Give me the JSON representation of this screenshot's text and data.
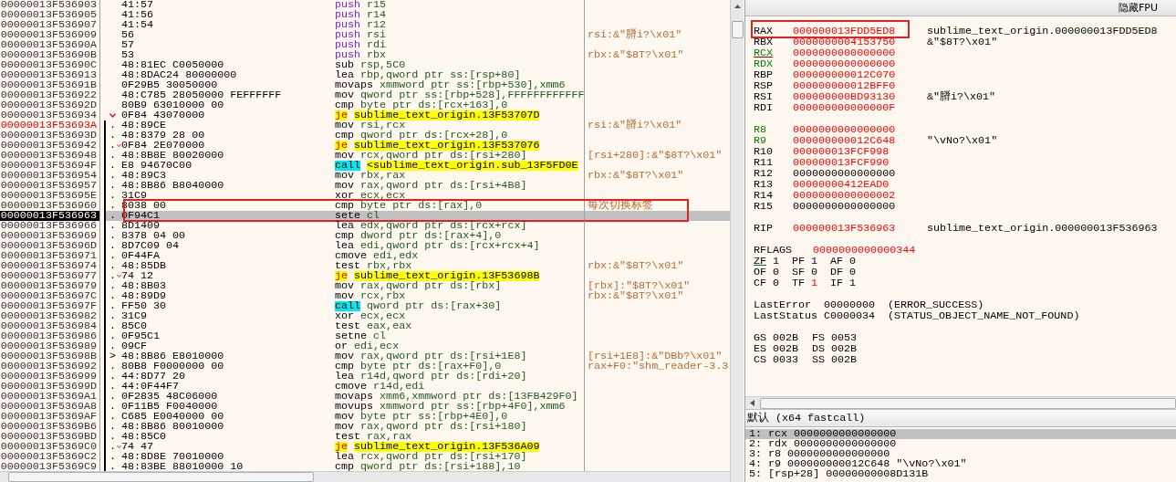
{
  "disassembly": {
    "rows": [
      {
        "address": "00000013F536903",
        "bytes": "41:57",
        "mnemonic": "push",
        "operands": "r15",
        "kind": "push",
        "jump": false,
        "in_branch": false,
        "highlighted": false,
        "selected": false,
        "boxed": false
      },
      {
        "address": "00000013F536905",
        "bytes": "41:56",
        "mnemonic": "push",
        "operands": "r14",
        "kind": "push",
        "jump": false,
        "in_branch": false,
        "highlighted": false,
        "selected": false,
        "boxed": false
      },
      {
        "address": "00000013F536907",
        "bytes": "41:54",
        "mnemonic": "push",
        "operands": "r12",
        "kind": "push",
        "jump": false,
        "in_branch": false,
        "highlighted": false,
        "selected": false,
        "boxed": false
      },
      {
        "address": "00000013F536909",
        "bytes": "56",
        "mnemonic": "push",
        "operands": "rsi",
        "kind": "push",
        "comment": "rsi:&\"膌i?\\x01\"",
        "jump": false,
        "in_branch": false,
        "highlighted": false,
        "selected": false,
        "boxed": false
      },
      {
        "address": "00000013F53690A",
        "bytes": "57",
        "mnemonic": "push",
        "operands": "rdi",
        "kind": "push",
        "jump": false,
        "in_branch": false,
        "highlighted": false,
        "selected": false,
        "boxed": false
      },
      {
        "address": "00000013F53690B",
        "bytes": "53",
        "mnemonic": "push",
        "operands": "rbx",
        "kind": "push",
        "comment": "rbx:&\"$8T?\\x01\"",
        "jump": false,
        "in_branch": false,
        "highlighted": false,
        "selected": false,
        "boxed": false
      },
      {
        "address": "00000013F53690C",
        "bytes": "48:81EC C0050000",
        "mnemonic": "sub",
        "operands": "rsp,5C0",
        "kind": "plain",
        "jump": false,
        "in_branch": false,
        "highlighted": false,
        "selected": false,
        "boxed": false
      },
      {
        "address": "00000013F536913",
        "bytes": "48:8DAC24 80000000",
        "mnemonic": "lea",
        "operands": "rbp,qword ptr ss:[rsp+80]",
        "kind": "plain",
        "jump": false,
        "in_branch": false,
        "highlighted": false,
        "selected": false,
        "boxed": false
      },
      {
        "address": "00000013F53691B",
        "bytes": "0F29B5 30050000",
        "mnemonic": "movaps",
        "operands": "xmmword ptr ss:[rbp+530],xmm6",
        "kind": "plain",
        "jump": false,
        "in_branch": false,
        "highlighted": false,
        "selected": false,
        "boxed": false
      },
      {
        "address": "00000013F536922",
        "bytes": "48:C785 28050000 FEFFFFFF",
        "mnemonic": "mov",
        "operands": "qword ptr ss:[rbp+528],FFFFFFFFFFFF",
        "kind": "plain",
        "jump": false,
        "in_branch": false,
        "highlighted": false,
        "selected": false,
        "boxed": false
      },
      {
        "address": "00000013F53692D",
        "bytes": "80B9 63010000 00",
        "mnemonic": "cmp",
        "operands": "byte ptr ds:[rcx+163],0",
        "kind": "plain",
        "jump": false,
        "in_branch": false,
        "highlighted": false,
        "selected": false,
        "boxed": false
      },
      {
        "address": "00000013F536934",
        "bytes": "0F84 43070000",
        "mnemonic": "je",
        "operands": "sublime_text_origin.13F53707D",
        "kind": "jump",
        "jump": true,
        "in_branch": false,
        "highlighted": false,
        "selected": false,
        "boxed": false
      },
      {
        "address": "00000013F53693A",
        "gutter": ".",
        "bytes": "48:89CE",
        "mnemonic": "mov",
        "operands": "rsi,rcx",
        "kind": "plain",
        "comment": "rsi:&\"膌i?\\x01\"",
        "jump": false,
        "in_branch": true,
        "highlighted": true,
        "selected": false,
        "boxed": false
      },
      {
        "address": "00000013F53693D",
        "gutter": ".",
        "bytes": "48:8379 28 00",
        "mnemonic": "cmp",
        "operands": "qword ptr ds:[rcx+28],0",
        "kind": "plain",
        "jump": false,
        "in_branch": true,
        "highlighted": false,
        "selected": false,
        "boxed": false
      },
      {
        "address": "00000013F536942",
        "gutter": ".",
        "bytes": "0F84 2E070000",
        "mnemonic": "je",
        "operands": "sublime_text_origin.13F537076",
        "kind": "jump",
        "jump": true,
        "in_branch": true,
        "highlighted": false,
        "selected": false,
        "boxed": false
      },
      {
        "address": "00000013F536948",
        "gutter": ".",
        "bytes": "48:8B8E 80020000",
        "mnemonic": "mov",
        "operands": "rcx,qword ptr ds:[rsi+280]",
        "kind": "plain",
        "comment": "[rsi+280]:&\"$8T?\\x01\"",
        "jump": false,
        "in_branch": true,
        "highlighted": false,
        "selected": false,
        "boxed": false
      },
      {
        "address": "00000013F53694F",
        "gutter": ".",
        "bytes": "E8 94670C00",
        "mnemonic": "call",
        "operands": "<sublime_text_origin.sub_13F5FD0E",
        "kind": "call_direct",
        "jump": false,
        "in_branch": true,
        "highlighted": false,
        "selected": false,
        "boxed": false
      },
      {
        "address": "00000013F536954",
        "gutter": ".",
        "bytes": "48:89C3",
        "mnemonic": "mov",
        "operands": "rbx,rax",
        "kind": "plain",
        "comment": "rbx:&\"$8T?\\x01\"",
        "jump": false,
        "in_branch": true,
        "highlighted": false,
        "selected": false,
        "boxed": false
      },
      {
        "address": "00000013F536957",
        "gutter": ".",
        "bytes": "48:8B86 B8040000",
        "mnemonic": "mov",
        "operands": "rax,qword ptr ds:[rsi+4B8]",
        "kind": "plain",
        "jump": false,
        "in_branch": true,
        "highlighted": false,
        "selected": false,
        "boxed": false
      },
      {
        "address": "00000013F53695E",
        "gutter": ".",
        "bytes": "31C9",
        "mnemonic": "xor",
        "operands": "ecx,ecx",
        "kind": "plain",
        "jump": false,
        "in_branch": true,
        "highlighted": false,
        "selected": false,
        "boxed": false
      },
      {
        "address": "00000013F536960",
        "gutter": ".",
        "bytes": "8038 00",
        "mnemonic": "cmp",
        "operands": "byte ptr ds:[rax],0",
        "kind": "plain",
        "comment": "每次切换标签",
        "jump": false,
        "in_branch": true,
        "highlighted": false,
        "selected": false,
        "boxed": true
      },
      {
        "address": "00000013F536963",
        "gutter": ".",
        "bytes": "0F94C1",
        "mnemonic": "sete",
        "operands": "cl",
        "kind": "plain",
        "jump": false,
        "in_branch": true,
        "highlighted": false,
        "selected": true,
        "boxed": true
      },
      {
        "address": "00000013F536966",
        "gutter": ".",
        "bytes": "8D1409",
        "mnemonic": "lea",
        "operands": "edx,qword ptr ds:[rcx+rcx]",
        "kind": "plain",
        "jump": false,
        "in_branch": true,
        "highlighted": false,
        "selected": false,
        "boxed": false
      },
      {
        "address": "00000013F536969",
        "gutter": ".",
        "bytes": "8378 04 00",
        "mnemonic": "cmp",
        "operands": "dword ptr ds:[rax+4],0",
        "kind": "plain",
        "jump": false,
        "in_branch": true,
        "highlighted": false,
        "selected": false,
        "boxed": false
      },
      {
        "address": "00000013F53696D",
        "gutter": ".",
        "bytes": "8D7C09 04",
        "mnemonic": "lea",
        "operands": "edi,qword ptr ds:[rcx+rcx+4]",
        "kind": "plain",
        "jump": false,
        "in_branch": true,
        "highlighted": false,
        "selected": false,
        "boxed": false
      },
      {
        "address": "00000013F536971",
        "gutter": ".",
        "bytes": "0F44FA",
        "mnemonic": "cmove",
        "operands": "edi,edx",
        "kind": "plain",
        "jump": false,
        "in_branch": true,
        "highlighted": false,
        "selected": false,
        "boxed": false
      },
      {
        "address": "00000013F536974",
        "gutter": ".",
        "bytes": "48:85DB",
        "mnemonic": "test",
        "operands": "rbx,rbx",
        "kind": "plain",
        "comment": "rbx:&\"$8T?\\x01\"",
        "jump": false,
        "in_branch": true,
        "highlighted": false,
        "selected": false,
        "boxed": false
      },
      {
        "address": "00000013F536977",
        "gutter": ".",
        "bytes": "74 12",
        "mnemonic": "je",
        "operands": "sublime_text_origin.13F53698B",
        "kind": "jump",
        "jump": true,
        "in_branch": true,
        "highlighted": false,
        "selected": false,
        "boxed": false
      },
      {
        "address": "00000013F536979",
        "gutter": ".",
        "bytes": "48:8B03",
        "mnemonic": "mov",
        "operands": "rax,qword ptr ds:[rbx]",
        "kind": "plain",
        "comment": "[rbx]:\"$8T?\\x01\"",
        "jump": false,
        "in_branch": true,
        "highlighted": false,
        "selected": false,
        "boxed": false
      },
      {
        "address": "00000013F53697C",
        "gutter": ".",
        "bytes": "48:89D9",
        "mnemonic": "mov",
        "operands": "rcx,rbx",
        "kind": "plain",
        "comment": "rbx:&\"$8T?\\x01\"",
        "jump": false,
        "in_branch": true,
        "highlighted": false,
        "selected": false,
        "boxed": false
      },
      {
        "address": "00000013F53697F",
        "gutter": ".",
        "bytes": "FF50 30",
        "mnemonic": "call",
        "operands": "qword ptr ds:[rax+30]",
        "kind": "call_indirect",
        "jump": false,
        "in_branch": true,
        "highlighted": false,
        "selected": false,
        "boxed": false
      },
      {
        "address": "00000013F536982",
        "gutter": ".",
        "bytes": "31C9",
        "mnemonic": "xor",
        "operands": "ecx,ecx",
        "kind": "plain",
        "jump": false,
        "in_branch": true,
        "highlighted": false,
        "selected": false,
        "boxed": false
      },
      {
        "address": "00000013F536984",
        "gutter": ".",
        "bytes": "85C0",
        "mnemonic": "test",
        "operands": "eax,eax",
        "kind": "plain",
        "jump": false,
        "in_branch": true,
        "highlighted": false,
        "selected": false,
        "boxed": false
      },
      {
        "address": "00000013F536986",
        "gutter": ".",
        "bytes": "0F95C1",
        "mnemonic": "setne",
        "operands": "cl",
        "kind": "plain",
        "jump": false,
        "in_branch": true,
        "highlighted": false,
        "selected": false,
        "boxed": false
      },
      {
        "address": "00000013F536989",
        "gutter": ".",
        "bytes": "09CF",
        "mnemonic": "or",
        "operands": "edi,ecx",
        "kind": "plain",
        "jump": false,
        "in_branch": true,
        "highlighted": false,
        "selected": false,
        "boxed": false
      },
      {
        "address": "00000013F53698B",
        "gutter": ">",
        "bytes": "48:8B86 E8010000",
        "mnemonic": "mov",
        "operands": "rax,qword ptr ds:[rsi+1E8]",
        "kind": "plain",
        "comment": "[rsi+1E8]:&\"DBb?\\x01\"",
        "jump": false,
        "in_branch": true,
        "highlighted": false,
        "selected": false,
        "boxed": false
      },
      {
        "address": "00000013F536992",
        "gutter": ".",
        "bytes": "80B8 F0000000 00",
        "mnemonic": "cmp",
        "operands": "byte ptr ds:[rax+F0],0",
        "kind": "plain",
        "comment": "rax+F0:\"shm_reader-3.3",
        "jump": false,
        "in_branch": true,
        "highlighted": false,
        "selected": false,
        "boxed": false
      },
      {
        "address": "00000013F536999",
        "gutter": ".",
        "bytes": "44:8D77 20",
        "mnemonic": "lea",
        "operands": "r14d,qword ptr ds:[rdi+20]",
        "kind": "plain",
        "jump": false,
        "in_branch": true,
        "highlighted": false,
        "selected": false,
        "boxed": false
      },
      {
        "address": "00000013F53699D",
        "gutter": ".",
        "bytes": "44:0F44F7",
        "mnemonic": "cmove",
        "operands": "r14d,edi",
        "kind": "plain",
        "jump": false,
        "in_branch": true,
        "highlighted": false,
        "selected": false,
        "boxed": false
      },
      {
        "address": "00000013F5369A1",
        "gutter": ".",
        "bytes": "0F2835 48C06000",
        "mnemonic": "movaps",
        "operands": "xmm6,xmmword ptr ds:[13FB429F0]",
        "kind": "plain",
        "jump": false,
        "in_branch": true,
        "highlighted": false,
        "selected": false,
        "boxed": false
      },
      {
        "address": "00000013F5369A8",
        "gutter": ".",
        "bytes": "0F11B5 F0040000",
        "mnemonic": "movups",
        "operands": "xmmword ptr ss:[rbp+4F0],xmm6",
        "kind": "plain",
        "jump": false,
        "in_branch": true,
        "highlighted": false,
        "selected": false,
        "boxed": false
      },
      {
        "address": "00000013F5369AF",
        "gutter": ".",
        "bytes": "C685 E0040000 00",
        "mnemonic": "mov",
        "operands": "byte ptr ss:[rbp+4E0],0",
        "kind": "plain",
        "jump": false,
        "in_branch": true,
        "highlighted": false,
        "selected": false,
        "boxed": false
      },
      {
        "address": "00000013F5369B6",
        "gutter": ".",
        "bytes": "48:8B86 80010000",
        "mnemonic": "mov",
        "operands": "rax,qword ptr ds:[rsi+180]",
        "kind": "plain",
        "jump": false,
        "in_branch": true,
        "highlighted": false,
        "selected": false,
        "boxed": false
      },
      {
        "address": "00000013F5369BD",
        "gutter": ".",
        "bytes": "48:85C0",
        "mnemonic": "test",
        "operands": "rax,rax",
        "kind": "plain",
        "jump": false,
        "in_branch": true,
        "highlighted": false,
        "selected": false,
        "boxed": false
      },
      {
        "address": "00000013F5369C0",
        "gutter": ".",
        "bytes": "74 47",
        "mnemonic": "je",
        "operands": "sublime_text_origin.13F536A09",
        "kind": "jump",
        "jump": true,
        "in_branch": true,
        "highlighted": false,
        "selected": false,
        "boxed": false
      },
      {
        "address": "00000013F5369C2",
        "gutter": ".",
        "bytes": "48:8D8E 70010000",
        "mnemonic": "lea",
        "operands": "rcx,qword ptr ds:[rsi+170]",
        "kind": "plain",
        "jump": false,
        "in_branch": true,
        "highlighted": false,
        "selected": false,
        "boxed": false
      },
      {
        "address": "00000013F5369C9",
        "gutter": ".",
        "bytes": "48:83BE 88010000 10",
        "mnemonic": "cmp",
        "operands": "qword ptr ds:[rsi+188],10",
        "kind": "plain",
        "jump": false,
        "in_branch": true,
        "highlighted": false,
        "selected": false,
        "boxed": false
      }
    ]
  },
  "registers_panel": {
    "hide_fpu_button": "隐藏FPU",
    "groups": [
      [
        {
          "name": "RAX",
          "value": "000000013FDD5ED8",
          "comment": "sublime_text_origin.000000013FDD5ED8",
          "changed": true,
          "arg": false,
          "underlined": false,
          "boxed": true
        },
        {
          "name": "RBX",
          "value": "0000000004153750",
          "comment": "&\"$8T?\\x01\"",
          "changed": true,
          "arg": false,
          "underlined": false,
          "boxed": false
        },
        {
          "name": "RCX",
          "value": "0000000000000000",
          "changed": true,
          "arg": true,
          "underlined": true,
          "boxed": false
        },
        {
          "name": "RDX",
          "value": "0000000000000000",
          "changed": true,
          "arg": true,
          "underlined": false,
          "boxed": false
        },
        {
          "name": "RBP",
          "value": "000000000012C070",
          "changed": true,
          "arg": false,
          "underlined": false,
          "boxed": false
        },
        {
          "name": "RSP",
          "value": "000000000012BFF0",
          "changed": true,
          "arg": false,
          "underlined": false,
          "boxed": false
        },
        {
          "name": "RSI",
          "value": "000000000BD93130",
          "comment": "&\"膌i?\\x01\"",
          "changed": true,
          "arg": false,
          "underlined": false,
          "boxed": false
        },
        {
          "name": "RDI",
          "value": "000000000000000F",
          "changed": true,
          "arg": false,
          "underlined": false,
          "boxed": false
        }
      ],
      [
        {
          "name": "R8",
          "value": "0000000000000000",
          "changed": true,
          "arg": true,
          "underlined": false,
          "boxed": false
        },
        {
          "name": "R9",
          "value": "000000000012C648",
          "comment": "\"\\vNo?\\x01\"",
          "changed": true,
          "arg": true,
          "underlined": false,
          "boxed": false
        },
        {
          "name": "R10",
          "value": "000000013FCF998",
          "changed": true,
          "arg": false,
          "underlined": false,
          "boxed": false
        },
        {
          "name": "R11",
          "value": "000000013FCF990",
          "changed": true,
          "arg": false,
          "underlined": false,
          "boxed": false
        },
        {
          "name": "R12",
          "value": "0000000000000000",
          "changed": false,
          "arg": false,
          "underlined": false,
          "boxed": false
        },
        {
          "name": "R13",
          "value": "00000000412EAD0",
          "changed": true,
          "arg": false,
          "underlined": false,
          "boxed": false
        },
        {
          "name": "R14",
          "value": "0000000000000002",
          "changed": true,
          "arg": false,
          "underlined": false,
          "boxed": false
        },
        {
          "name": "R15",
          "value": "0000000000000000",
          "changed": false,
          "arg": false,
          "underlined": false,
          "boxed": false
        }
      ],
      [
        {
          "name": "RIP",
          "value": "000000013F536963",
          "comment": "sublime_text_origin.000000013F536963",
          "changed": true,
          "arg": false,
          "underlined": false,
          "boxed": false
        }
      ]
    ],
    "rflags": {
      "name": "RFLAGS",
      "value": "0000000000000344",
      "changed": true
    },
    "flags": [
      [
        {
          "name": "ZF",
          "value": "1",
          "changed": false,
          "underlined": true
        },
        {
          "name": "PF",
          "value": "1",
          "changed": false,
          "underlined": false
        },
        {
          "name": "AF",
          "value": "0",
          "changed": false,
          "underlined": false
        }
      ],
      [
        {
          "name": "OF",
          "value": "0",
          "changed": false,
          "underlined": false
        },
        {
          "name": "SF",
          "value": "0",
          "changed": false,
          "underlined": false
        },
        {
          "name": "DF",
          "value": "0",
          "changed": false,
          "underlined": false
        }
      ],
      [
        {
          "name": "CF",
          "value": "0",
          "changed": false,
          "underlined": false
        },
        {
          "name": "TF",
          "value": "1",
          "changed": true,
          "underlined": false
        },
        {
          "name": "IF",
          "value": "1",
          "changed": false,
          "underlined": false
        }
      ]
    ],
    "status": [
      {
        "name": "LastError",
        "code": "00000000",
        "text": "(ERROR_SUCCESS)"
      },
      {
        "name": "LastStatus",
        "code": "C0000034",
        "text": "(STATUS_OBJECT_NAME_NOT_FOUND)"
      }
    ],
    "segments": [
      [
        {
          "name": "GS",
          "value": "002B"
        },
        {
          "name": "FS",
          "value": "0053"
        }
      ],
      [
        {
          "name": "ES",
          "value": "002B"
        },
        {
          "name": "DS",
          "value": "002B"
        }
      ],
      [
        {
          "name": "CS",
          "value": "0033"
        },
        {
          "name": "SS",
          "value": "002B"
        }
      ]
    ]
  },
  "call_panel": {
    "title": "默认 (x64 fastcall)",
    "args": [
      {
        "text": "1: rcx 0000000000000000",
        "selected": true
      },
      {
        "text": "2: rdx 0000000000000000",
        "selected": false
      },
      {
        "text": "3: r8 0000000000000000",
        "selected": false
      },
      {
        "text": "4: r9 000000000012C648 \"\\vNo?\\x01\"",
        "selected": false
      },
      {
        "text": "5: [rsp+28] 00000000008D131B",
        "selected": false
      }
    ]
  }
}
